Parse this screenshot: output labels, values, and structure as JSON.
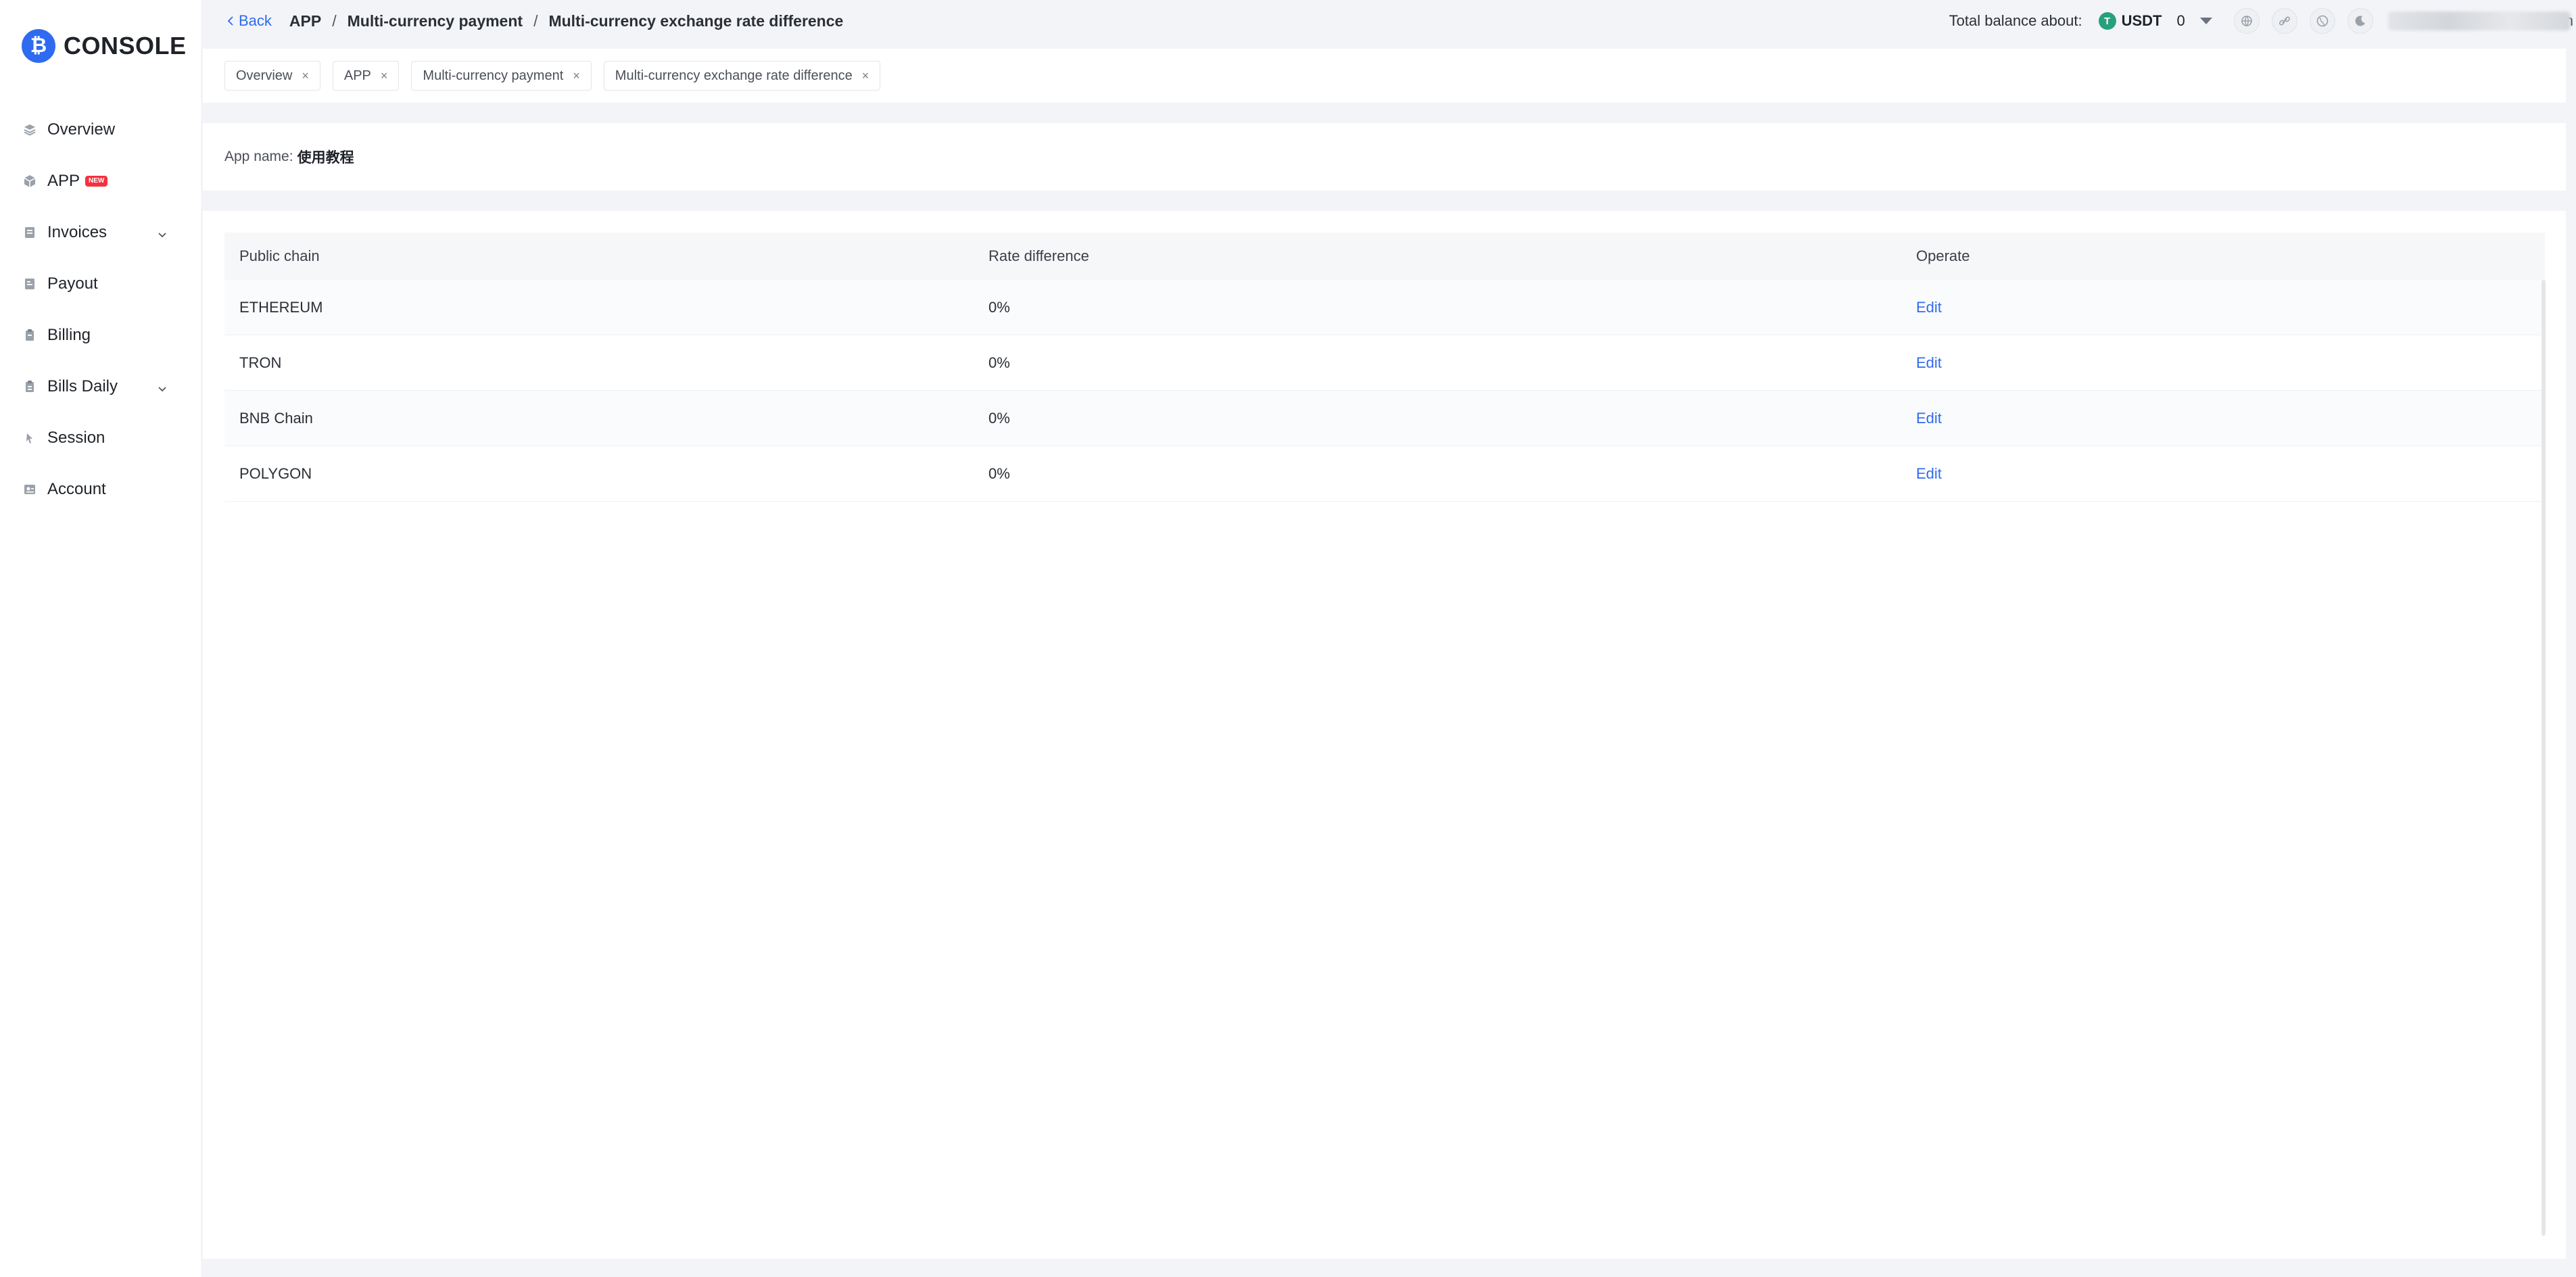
{
  "logo": {
    "mark": "₿",
    "text": "CONSOLE"
  },
  "sidebar": {
    "items": [
      {
        "label": "Overview",
        "icon": "layers-icon"
      },
      {
        "label": "APP",
        "icon": "cube-icon",
        "badge": "NEW"
      },
      {
        "label": "Invoices",
        "icon": "invoice-icon",
        "expandable": true
      },
      {
        "label": "Payout",
        "icon": "payout-icon"
      },
      {
        "label": "Billing",
        "icon": "billing-icon"
      },
      {
        "label": "Bills Daily",
        "icon": "bills-daily-icon",
        "expandable": true
      },
      {
        "label": "Session",
        "icon": "session-icon"
      },
      {
        "label": "Account",
        "icon": "account-icon"
      }
    ]
  },
  "header": {
    "back_label": "Back",
    "breadcrumb": [
      "APP",
      "Multi-currency payment",
      "Multi-currency exchange rate difference"
    ],
    "balance_label": "Total balance about:",
    "currency": "USDT",
    "currency_icon_letter": "T",
    "balance_value": "0",
    "user_tail": "n"
  },
  "tags": [
    {
      "label": "Overview"
    },
    {
      "label": "APP"
    },
    {
      "label": "Multi-currency payment"
    },
    {
      "label": "Multi-currency exchange rate difference"
    }
  ],
  "app_info": {
    "label": "App name:",
    "value": "使用教程"
  },
  "table": {
    "columns": [
      "Public chain",
      "Rate difference",
      "Operate"
    ],
    "rows": [
      {
        "chain": "ETHEREUM",
        "rate": "0%",
        "action": "Edit"
      },
      {
        "chain": "TRON",
        "rate": "0%",
        "action": "Edit"
      },
      {
        "chain": "BNB Chain",
        "rate": "0%",
        "action": "Edit"
      },
      {
        "chain": "POLYGON",
        "rate": "0%",
        "action": "Edit"
      }
    ]
  },
  "colors": {
    "accent": "#2f6bf0",
    "badge": "#f5313d",
    "usdt": "#26a17b"
  }
}
